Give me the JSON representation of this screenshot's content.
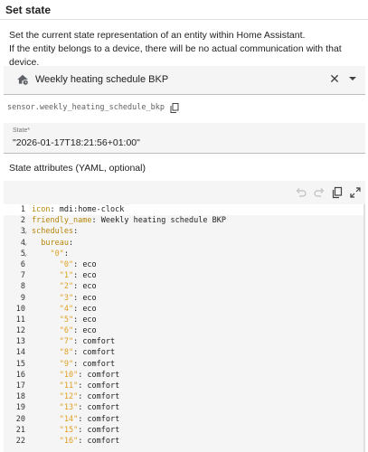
{
  "header": {
    "title": "Set state"
  },
  "description": {
    "line1": "Set the current state representation of an entity within Home Assistant.",
    "line2": "If the entity belongs to a device, there will be no actual communication with that device."
  },
  "entity": {
    "icon": "home-clock-icon",
    "name": "Weekly heating schedule BKP",
    "entity_id": "sensor.weekly_heating_schedule_bkp"
  },
  "state": {
    "label": "State*",
    "value": "\"2026-01-17T18:21:56+01:00\""
  },
  "attributes": {
    "title": "State attributes (YAML, optional)"
  },
  "editor": {
    "lines": [
      {
        "n": "1",
        "fold": "",
        "key": "icon",
        "sep": ": ",
        "val": "mdi:home-clock",
        "indent": "",
        "quoted": false
      },
      {
        "n": "2",
        "fold": "",
        "key": "friendly_name",
        "sep": ": ",
        "val": "Weekly heating schedule BKP",
        "indent": "",
        "quoted": false
      },
      {
        "n": "3",
        "fold": "v",
        "key": "schedules",
        "sep": ":",
        "val": "",
        "indent": "",
        "quoted": false
      },
      {
        "n": "4",
        "fold": "v",
        "key": "bureau",
        "sep": ":",
        "val": "",
        "indent": "  ",
        "quoted": false
      },
      {
        "n": "5",
        "fold": "v",
        "key": "\"0\"",
        "sep": ":",
        "val": "",
        "indent": "    ",
        "quoted": true
      },
      {
        "n": "6",
        "fold": "",
        "key": "\"0\"",
        "sep": ": ",
        "val": "eco",
        "indent": "      ",
        "quoted": true
      },
      {
        "n": "7",
        "fold": "",
        "key": "\"1\"",
        "sep": ": ",
        "val": "eco",
        "indent": "      ",
        "quoted": true
      },
      {
        "n": "8",
        "fold": "",
        "key": "\"2\"",
        "sep": ": ",
        "val": "eco",
        "indent": "      ",
        "quoted": true
      },
      {
        "n": "9",
        "fold": "",
        "key": "\"3\"",
        "sep": ": ",
        "val": "eco",
        "indent": "      ",
        "quoted": true
      },
      {
        "n": "10",
        "fold": "",
        "key": "\"4\"",
        "sep": ": ",
        "val": "eco",
        "indent": "      ",
        "quoted": true
      },
      {
        "n": "11",
        "fold": "",
        "key": "\"5\"",
        "sep": ": ",
        "val": "eco",
        "indent": "      ",
        "quoted": true
      },
      {
        "n": "12",
        "fold": "",
        "key": "\"6\"",
        "sep": ": ",
        "val": "eco",
        "indent": "      ",
        "quoted": true
      },
      {
        "n": "13",
        "fold": "",
        "key": "\"7\"",
        "sep": ": ",
        "val": "comfort",
        "indent": "      ",
        "quoted": true
      },
      {
        "n": "14",
        "fold": "",
        "key": "\"8\"",
        "sep": ": ",
        "val": "comfort",
        "indent": "      ",
        "quoted": true
      },
      {
        "n": "15",
        "fold": "",
        "key": "\"9\"",
        "sep": ": ",
        "val": "comfort",
        "indent": "      ",
        "quoted": true
      },
      {
        "n": "16",
        "fold": "",
        "key": "\"10\"",
        "sep": ": ",
        "val": "comfort",
        "indent": "      ",
        "quoted": true
      },
      {
        "n": "17",
        "fold": "",
        "key": "\"11\"",
        "sep": ": ",
        "val": "comfort",
        "indent": "      ",
        "quoted": true
      },
      {
        "n": "18",
        "fold": "",
        "key": "\"12\"",
        "sep": ": ",
        "val": "comfort",
        "indent": "      ",
        "quoted": true
      },
      {
        "n": "19",
        "fold": "",
        "key": "\"13\"",
        "sep": ": ",
        "val": "comfort",
        "indent": "      ",
        "quoted": true
      },
      {
        "n": "20",
        "fold": "",
        "key": "\"14\"",
        "sep": ": ",
        "val": "comfort",
        "indent": "      ",
        "quoted": true
      },
      {
        "n": "21",
        "fold": "",
        "key": "\"15\"",
        "sep": ": ",
        "val": "comfort",
        "indent": "      ",
        "quoted": true
      },
      {
        "n": "22",
        "fold": "",
        "key": "\"16\"",
        "sep": ": ",
        "val": "comfort",
        "indent": "      ",
        "quoted": true
      }
    ]
  },
  "colors": {
    "key": "#b8860b",
    "quoted_key": "#e0a020",
    "field_bg": "#f5f5f5"
  }
}
